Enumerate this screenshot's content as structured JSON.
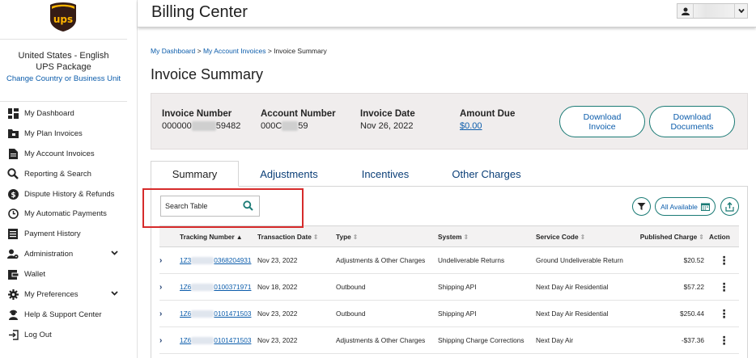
{
  "brand": {
    "logo_text": "ups",
    "colors": {
      "brown": "#351c15",
      "gold": "#ffb500",
      "accent": "#1a7a75",
      "link": "#0b5cab",
      "highlight": "#d62b2b"
    }
  },
  "sidebar": {
    "region_line1": "United States - English",
    "region_line2": "UPS Package",
    "change_link": "Change Country or Business Unit",
    "items": [
      {
        "label": "My Dashboard",
        "icon": "dashboard-icon"
      },
      {
        "label": "My Plan Invoices",
        "icon": "folder-icon"
      },
      {
        "label": "My Account Invoices",
        "icon": "document-icon"
      },
      {
        "label": "Reporting & Search",
        "icon": "search-icon"
      },
      {
        "label": "Dispute History & Refunds",
        "icon": "dollar-icon"
      },
      {
        "label": "My Automatic Payments",
        "icon": "clock-icon"
      },
      {
        "label": "Payment History",
        "icon": "list-icon"
      },
      {
        "label": "Administration",
        "icon": "admin-icon"
      },
      {
        "label": "Wallet",
        "icon": "wallet-icon"
      },
      {
        "label": "My Preferences",
        "icon": "gear-icon"
      },
      {
        "label": "Help & Support Center",
        "icon": "support-icon"
      },
      {
        "label": "Log Out",
        "icon": "logout-icon"
      }
    ]
  },
  "header": {
    "title": "Billing Center"
  },
  "breadcrumb": {
    "item1": "My Dashboard",
    "sep1": " > ",
    "item2": "My Account Invoices",
    "sep2": " > ",
    "current": "Invoice Summary"
  },
  "page": {
    "title": "Invoice Summary"
  },
  "summary": {
    "invoice_number_label": "Invoice Number",
    "invoice_number_prefix": "000000",
    "invoice_number_suffix": "59482",
    "account_number_label": "Account Number",
    "account_number_prefix": "000C",
    "account_number_suffix": "59",
    "invoice_date_label": "Invoice Date",
    "invoice_date": "Nov 26, 2022",
    "amount_due_label": "Amount Due",
    "amount_due": "$0.00",
    "download_invoice_l1": "Download",
    "download_invoice_l2": "Invoice",
    "download_docs_l1": "Download",
    "download_docs_l2": "Documents"
  },
  "tabs": {
    "summary": "Summary",
    "adjustments": "Adjustments",
    "incentives": "Incentives",
    "other": "Other Charges"
  },
  "table_tools": {
    "search_placeholder": "Search Table",
    "all_available": "All Available"
  },
  "table": {
    "headers": {
      "tracking": "Tracking Number",
      "date": "Transaction Date",
      "type": "Type",
      "system": "System",
      "service": "Service Code",
      "charge": "Published Charge",
      "action": "Action"
    },
    "rows": [
      {
        "tracking_prefix": "1Z3",
        "tracking_suffix": "0368204931",
        "date": "Nov 23, 2022",
        "type": "Adjustments & Other Charges",
        "system": "Undeliverable Returns",
        "service": "Ground Undeliverable Return",
        "charge": "$20.52"
      },
      {
        "tracking_prefix": "1Z6",
        "tracking_suffix": "0100371971",
        "date": "Nov 18, 2022",
        "type": "Outbound",
        "system": "Shipping API",
        "service": "Next Day Air Residential",
        "charge": "$57.22"
      },
      {
        "tracking_prefix": "1Z6",
        "tracking_suffix": "0101471503",
        "date": "Nov 23, 2022",
        "type": "Outbound",
        "system": "Shipping API",
        "service": "Next Day Air Residential",
        "charge": "$250.44"
      },
      {
        "tracking_prefix": "1Z6",
        "tracking_suffix": "0101471503",
        "date": "Nov 23, 2022",
        "type": "Adjustments & Other Charges",
        "system": "Shipping Charge Corrections",
        "service": "Next Day Air",
        "charge": "-$37.36"
      }
    ]
  }
}
